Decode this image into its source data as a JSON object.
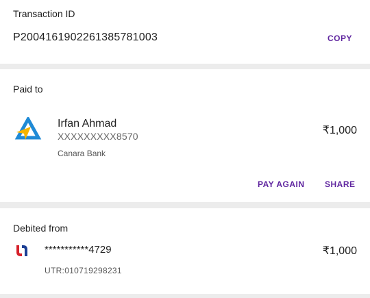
{
  "transaction": {
    "label": "Transaction ID",
    "id": "P2004161902261385781003",
    "copy_label": "COPY"
  },
  "paid_to": {
    "label": "Paid to",
    "name": "Irfan Ahmad",
    "account": "XXXXXXXXX8570",
    "bank": "Canara Bank",
    "amount": "₹1,000",
    "pay_again_label": "PAY AGAIN",
    "share_label": "SHARE",
    "bank_logo_icon": "canara-bank-logo-icon"
  },
  "debited_from": {
    "label": "Debited from",
    "account": "***********4729",
    "amount": "₹1,000",
    "utr": "UTR:010719298231",
    "bank_logo_icon": "union-bank-logo-icon"
  },
  "colors": {
    "accent": "#5f259f",
    "canara_blue": "#1f8ad6",
    "canara_yellow": "#f5b400",
    "union_red": "#d6202a",
    "union_blue": "#1c3f94",
    "divider": "#ececec"
  }
}
